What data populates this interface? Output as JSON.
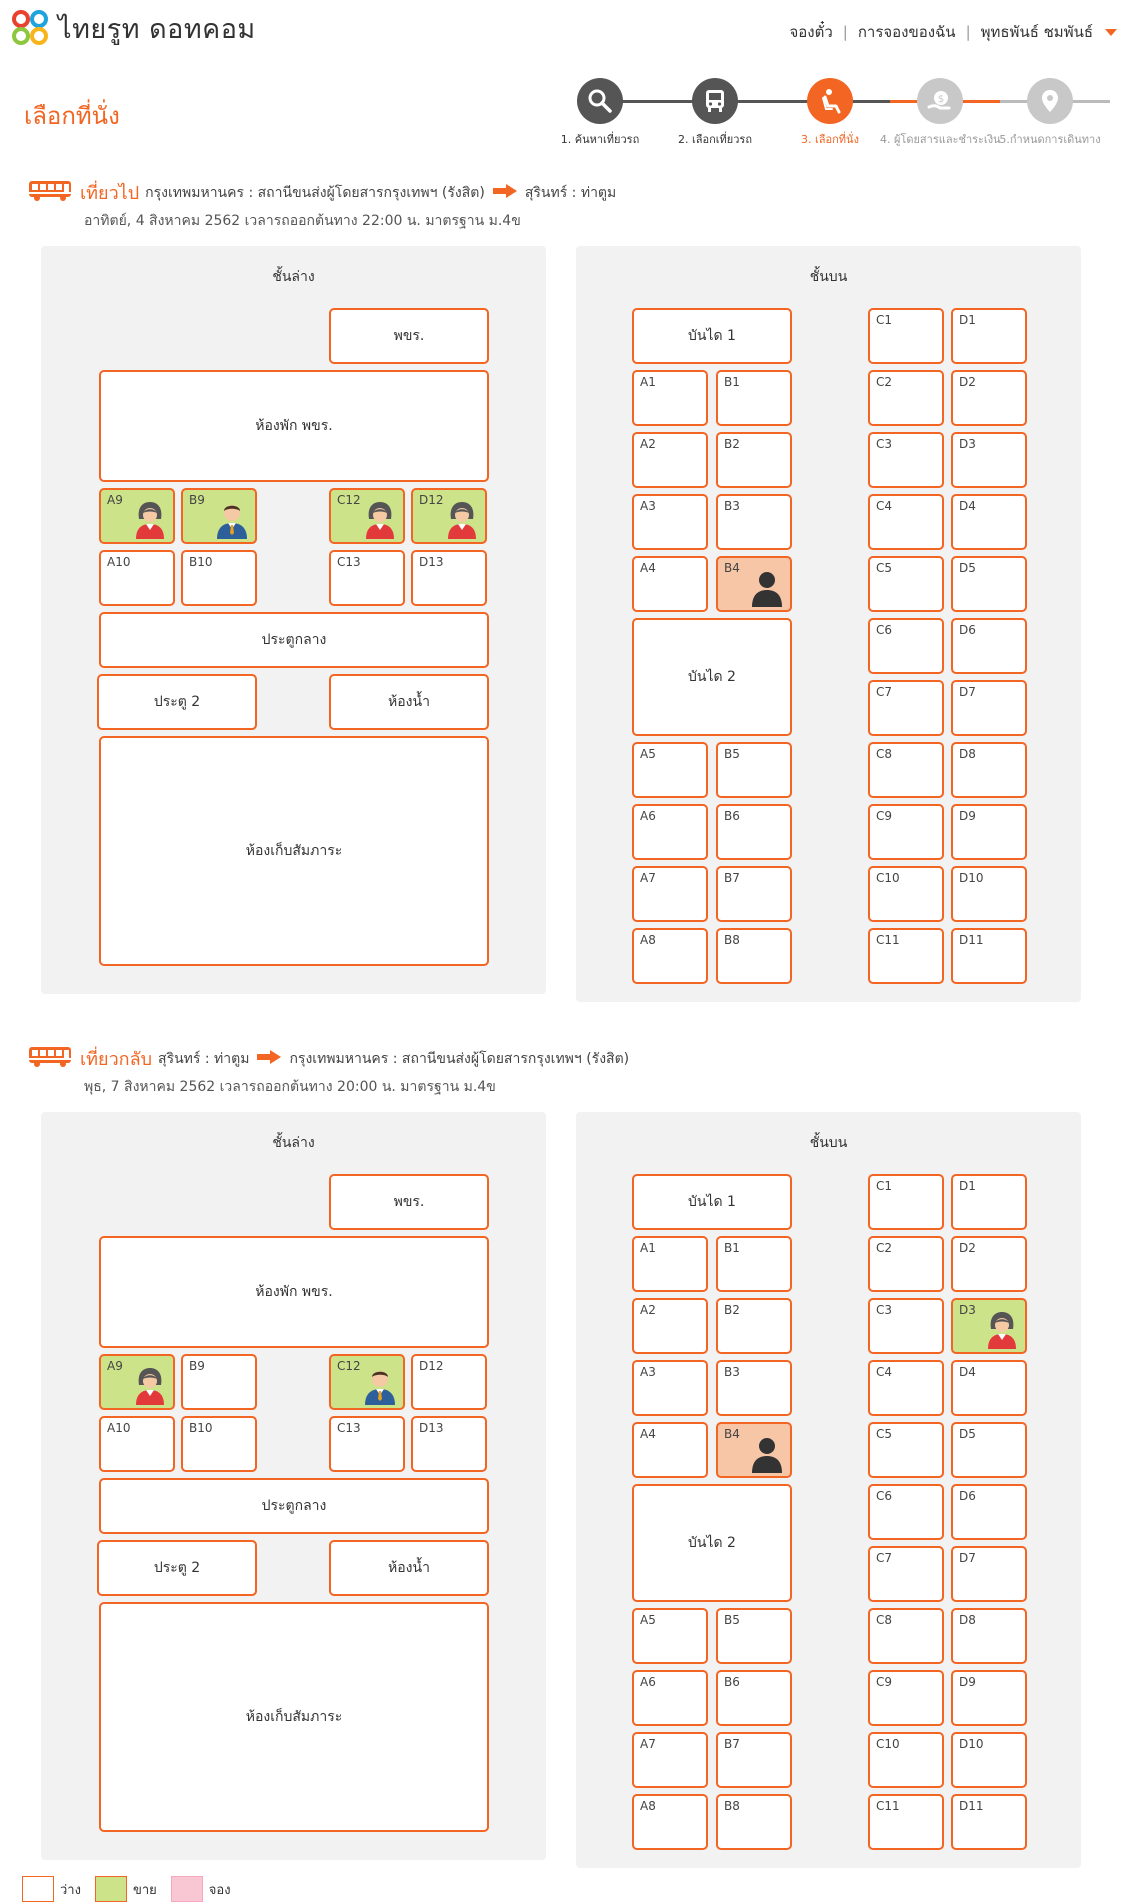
{
  "header": {
    "logo_text": "ไทยรูท ดอทคอม",
    "nav": [
      "จองตั๋ว",
      "การจองของฉัน",
      "พุทธพันธ์ ชมพันธ์"
    ]
  },
  "page_title": "เลือกที่นั่ง",
  "steps": [
    {
      "label": "1. ค้นหาเที่ยวรถ",
      "icon": "search-icon",
      "state": "done"
    },
    {
      "label": "2. เลือกเที่ยวรถ",
      "icon": "bus-icon",
      "state": "done"
    },
    {
      "label": "3. เลือกที่นั่ง",
      "icon": "seat-icon",
      "state": "active"
    },
    {
      "label": "4. ผู้โดยสารและชำระเงิน",
      "icon": "payment-icon",
      "state": "todo"
    },
    {
      "label": "5.กำหนดการเดินทาง",
      "icon": "location-icon",
      "state": "todo"
    }
  ],
  "colors": {
    "accent": "#f26522",
    "sold": "#cde38a",
    "booked": "#f7c6a7",
    "reserved": "#f9c6d3",
    "panel": "#f2f2f2"
  },
  "trips": [
    {
      "kind": "เที่ยวไป",
      "origin": "กรุงเทพมหานคร : สถานีขนส่งผู้โดยสารกรุงเทพฯ (รังสิต)",
      "destination": "สุรินทร์ : ท่าตูม",
      "date_line": "อาทิตย์, 4 สิงหาคม 2562 เวลารถออกต้นทาง 22:00 น. มาตรฐาน ม.4ข",
      "lower": {
        "title": "ชั้นล่าง",
        "fixtures": [
          "พขร.",
          "ห้องพัก พขร.",
          "ประตูกลาง",
          "ประตู 2",
          "ห้องน้ำ",
          "ห้องเก็บสัมภาระ"
        ],
        "seats": [
          {
            "code": "A9",
            "state": "sold",
            "person": "female"
          },
          {
            "code": "B9",
            "state": "sold",
            "person": "male"
          },
          {
            "code": "C12",
            "state": "sold",
            "person": "female"
          },
          {
            "code": "D12",
            "state": "sold",
            "person": "female"
          },
          {
            "code": "A10",
            "state": "free"
          },
          {
            "code": "B10",
            "state": "free"
          },
          {
            "code": "C13",
            "state": "free"
          },
          {
            "code": "D13",
            "state": "free"
          }
        ]
      },
      "upper": {
        "title": "ชั้นบน",
        "fixtures": [
          "บันได 1",
          "บันได 2"
        ],
        "left_seats": [
          {
            "code": "A1"
          },
          {
            "code": "B1"
          },
          {
            "code": "A2"
          },
          {
            "code": "B2"
          },
          {
            "code": "A3"
          },
          {
            "code": "B3"
          },
          {
            "code": "A4"
          },
          {
            "code": "B4",
            "state": "booked",
            "person": "unknown"
          },
          {
            "code": "A5"
          },
          {
            "code": "B5"
          },
          {
            "code": "A6"
          },
          {
            "code": "B6"
          },
          {
            "code": "A7"
          },
          {
            "code": "B7"
          },
          {
            "code": "A8"
          },
          {
            "code": "B8"
          }
        ],
        "right_seats": [
          {
            "code": "C1"
          },
          {
            "code": "D1"
          },
          {
            "code": "C2"
          },
          {
            "code": "D2"
          },
          {
            "code": "C3"
          },
          {
            "code": "D3"
          },
          {
            "code": "C4"
          },
          {
            "code": "D4"
          },
          {
            "code": "C5"
          },
          {
            "code": "D5"
          },
          {
            "code": "C6"
          },
          {
            "code": "D6"
          },
          {
            "code": "C7"
          },
          {
            "code": "D7"
          },
          {
            "code": "C8"
          },
          {
            "code": "D8"
          },
          {
            "code": "C9"
          },
          {
            "code": "D9"
          },
          {
            "code": "C10"
          },
          {
            "code": "D10"
          },
          {
            "code": "C11"
          },
          {
            "code": "D11"
          }
        ]
      }
    },
    {
      "kind": "เที่ยวกลับ",
      "origin": "สุรินทร์ : ท่าตูม",
      "destination": "กรุงเทพมหานคร : สถานีขนส่งผู้โดยสารกรุงเทพฯ (รังสิต)",
      "date_line": "พุธ, 7 สิงหาคม 2562  เวลารถออกต้นทาง 20:00 น. มาตรฐาน ม.4ข",
      "lower": {
        "title": "ชั้นล่าง",
        "fixtures": [
          "พขร.",
          "ห้องพัก พขร.",
          "ประตูกลาง",
          "ประตู 2",
          "ห้องน้ำ",
          "ห้องเก็บสัมภาระ"
        ],
        "seats": [
          {
            "code": "A9",
            "state": "sold",
            "person": "female"
          },
          {
            "code": "B9",
            "state": "free"
          },
          {
            "code": "C12",
            "state": "sold",
            "person": "male"
          },
          {
            "code": "D12",
            "state": "free"
          },
          {
            "code": "A10",
            "state": "free"
          },
          {
            "code": "B10",
            "state": "free"
          },
          {
            "code": "C13",
            "state": "free"
          },
          {
            "code": "D13",
            "state": "free"
          }
        ]
      },
      "upper": {
        "title": "ชั้นบน",
        "fixtures": [
          "บันได 1",
          "บันได 2"
        ],
        "left_seats": [
          {
            "code": "A1"
          },
          {
            "code": "B1"
          },
          {
            "code": "A2"
          },
          {
            "code": "B2"
          },
          {
            "code": "A3"
          },
          {
            "code": "B3"
          },
          {
            "code": "A4"
          },
          {
            "code": "B4",
            "state": "booked",
            "person": "unknown"
          },
          {
            "code": "A5"
          },
          {
            "code": "B5"
          },
          {
            "code": "A6"
          },
          {
            "code": "B6"
          },
          {
            "code": "A7"
          },
          {
            "code": "B7"
          },
          {
            "code": "A8"
          },
          {
            "code": "B8"
          }
        ],
        "right_seats": [
          {
            "code": "C1"
          },
          {
            "code": "D1"
          },
          {
            "code": "C2"
          },
          {
            "code": "D2"
          },
          {
            "code": "C3"
          },
          {
            "code": "D3",
            "state": "sold",
            "person": "female"
          },
          {
            "code": "C4"
          },
          {
            "code": "D4"
          },
          {
            "code": "C5"
          },
          {
            "code": "D5"
          },
          {
            "code": "C6"
          },
          {
            "code": "D6"
          },
          {
            "code": "C7"
          },
          {
            "code": "D7"
          },
          {
            "code": "C8"
          },
          {
            "code": "D8"
          },
          {
            "code": "C9"
          },
          {
            "code": "D9"
          },
          {
            "code": "C10"
          },
          {
            "code": "D10"
          },
          {
            "code": "C11"
          },
          {
            "code": "D11"
          }
        ]
      }
    }
  ],
  "legend": [
    {
      "label": "ว่าง",
      "color": "#ffffff"
    },
    {
      "label": "ขาย",
      "color": "#cde38a"
    },
    {
      "label": "จอง",
      "color": "#f9c6d3"
    }
  ]
}
